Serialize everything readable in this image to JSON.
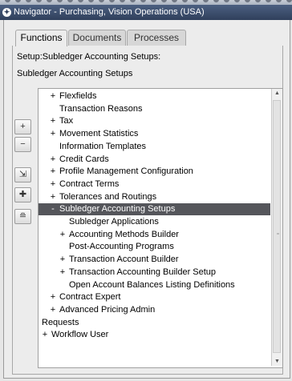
{
  "window": {
    "title": "Navigator - Purchasing, Vision Operations (USA)",
    "app_icon": "oracle-navigator-icon"
  },
  "tabs": [
    {
      "label": "Functions",
      "active": true
    },
    {
      "label": "Documents",
      "active": false
    },
    {
      "label": "Processes",
      "active": false
    }
  ],
  "breadcrumb": "Setup:Subledger Accounting Setups:",
  "section_title": "Subledger Accounting Setups",
  "side_buttons": [
    {
      "name": "expand-button",
      "icon": "plus-icon",
      "glyph": "+"
    },
    {
      "name": "collapse-button",
      "icon": "minus-icon",
      "glyph": "−"
    },
    {
      "name": "expand-branch-button",
      "icon": "expand-branch-icon",
      "glyph": "⇲"
    },
    {
      "name": "expand-all-button",
      "icon": "expand-all-icon",
      "glyph": "✚"
    },
    {
      "name": "collapse-all-button",
      "icon": "collapse-all-icon",
      "glyph": "≘"
    }
  ],
  "tree": [
    {
      "prefix": "+",
      "label": "Flexfields",
      "level": 0
    },
    {
      "prefix": "",
      "label": "Transaction Reasons",
      "level": 0
    },
    {
      "prefix": "+",
      "label": "Tax",
      "level": 0
    },
    {
      "prefix": "+",
      "label": "Movement Statistics",
      "level": 0
    },
    {
      "prefix": "",
      "label": "Information Templates",
      "level": 0
    },
    {
      "prefix": "+",
      "label": "Credit Cards",
      "level": 0
    },
    {
      "prefix": "+",
      "label": "Profile Management Configuration",
      "level": 0
    },
    {
      "prefix": "+",
      "label": "Contract Terms",
      "level": 0
    },
    {
      "prefix": "+",
      "label": "Tolerances and Routings",
      "level": 0
    },
    {
      "prefix": "-",
      "label": "Subledger Accounting Setups",
      "level": 0,
      "selected": true
    },
    {
      "prefix": "",
      "label": "Subledger Applications",
      "level": 1
    },
    {
      "prefix": "+",
      "label": "Accounting Methods Builder",
      "level": 1
    },
    {
      "prefix": "",
      "label": "Post-Accounting Programs",
      "level": 1
    },
    {
      "prefix": "+",
      "label": "Transaction Account Builder",
      "level": 1
    },
    {
      "prefix": "+",
      "label": "Transaction Accounting Builder Setup",
      "level": 1
    },
    {
      "prefix": "",
      "label": "Open Account Balances Listing Definitions",
      "level": 1
    },
    {
      "prefix": "+",
      "label": "Contract Expert",
      "level": 0
    },
    {
      "prefix": "+",
      "label": "Advanced Pricing Admin",
      "level": 0
    },
    {
      "prefix": "",
      "label": "Requests",
      "level": -1
    },
    {
      "prefix": "+",
      "label": "Workflow User",
      "level": -1
    }
  ],
  "colors": {
    "selected_row_bg": "#55565b",
    "titlebar_bg": "#3b4b6a"
  }
}
